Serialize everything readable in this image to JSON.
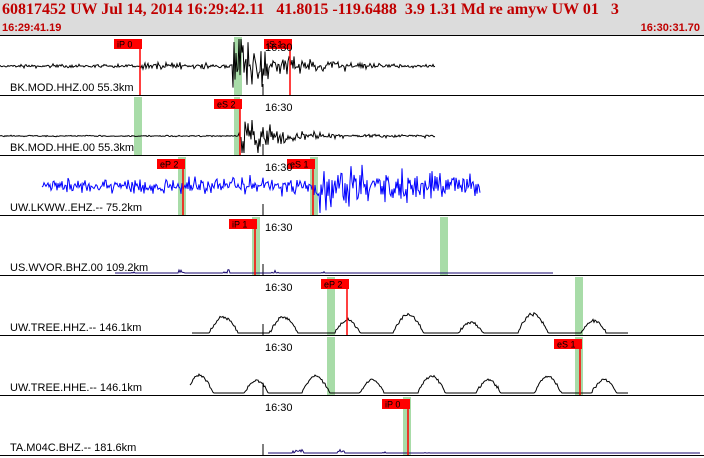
{
  "header": {
    "title": "60817452 UW Jul 14, 2014 16:29:42.11   41.8015 -119.6488  3.9 1.31 Md re amyw UW 01   3",
    "start_time": "16:29:41.19",
    "end_time": "16:30:31.70"
  },
  "colors": {
    "header_text": "#c00000",
    "header_bg": "#dcdcdc",
    "pick_flag": "#ff0000",
    "pick_window": "#a8dca8",
    "trace_black": "#000000",
    "trace_blue": "#0000ff",
    "trace_purple": "#1a0a70"
  },
  "channels": [
    {
      "label": "BK.MOD.HHZ.00 55.3km",
      "minute_label": "16:30",
      "trace_color": "black",
      "picks": [
        {
          "label": "iP 0"
        },
        {
          "label": "iS 1"
        }
      ]
    },
    {
      "label": "BK.MOD.HHE.00 55.3km",
      "minute_label": "16:30",
      "trace_color": "black",
      "picks": [
        {
          "label": "eS 2"
        }
      ]
    },
    {
      "label": "UW.LKWW..EHZ.-- 75.2km",
      "minute_label": "16:30",
      "trace_color": "blue",
      "picks": [
        {
          "label": "eP 2"
        },
        {
          "label": "eS 1"
        }
      ]
    },
    {
      "label": "US.WVOR.BHZ.00 109.2km",
      "minute_label": "16:30",
      "trace_color": "purple",
      "picks": [
        {
          "label": "iP 1"
        }
      ]
    },
    {
      "label": "UW.TREE.HHZ.-- 146.1km",
      "minute_label": "16:30",
      "trace_color": "black",
      "picks": [
        {
          "label": "eP 2"
        }
      ]
    },
    {
      "label": "UW.TREE.HHE.-- 146.1km",
      "minute_label": "16:30",
      "trace_color": "black",
      "picks": [
        {
          "label": "eS 1"
        }
      ]
    },
    {
      "label": "TA.M04C.BHZ.-- 181.6km",
      "minute_label": "16:30",
      "trace_color": "purple",
      "picks": [
        {
          "label": "iP 0"
        }
      ]
    }
  ]
}
